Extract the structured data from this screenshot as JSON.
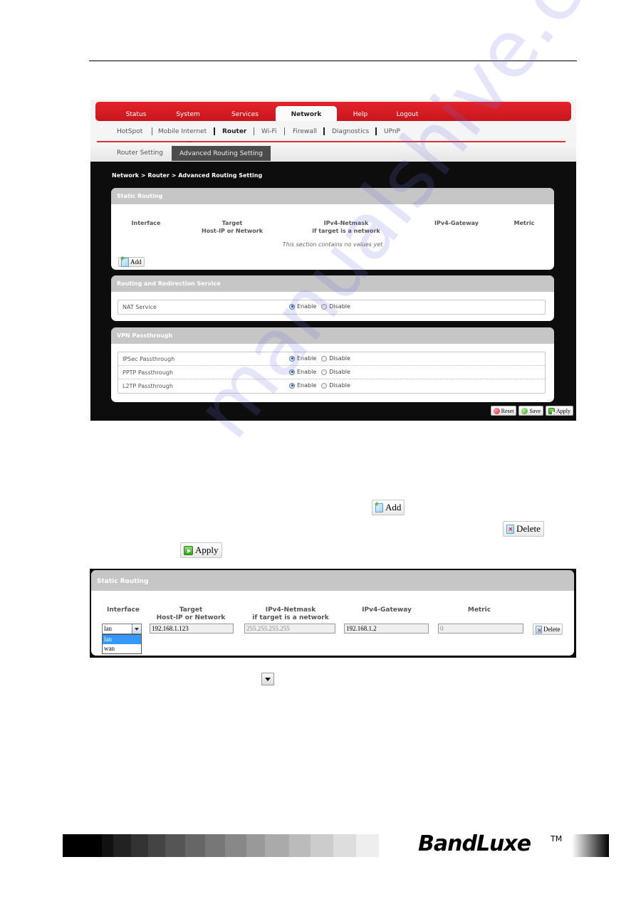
{
  "topnav": {
    "tabs": [
      {
        "label": "Status"
      },
      {
        "label": "System"
      },
      {
        "label": "Services"
      },
      {
        "label": "Network",
        "active": true
      },
      {
        "label": "Help"
      },
      {
        "label": "Logout"
      }
    ]
  },
  "subnav": {
    "items": [
      {
        "label": "HotSpot"
      },
      {
        "label": "Mobile Internet"
      },
      {
        "label": "Router",
        "active": true
      },
      {
        "label": "Wi-Fi"
      },
      {
        "label": "Firewall"
      },
      {
        "label": "Diagnostics"
      },
      {
        "label": "UPnP"
      }
    ]
  },
  "subsubnav": {
    "items": [
      {
        "label": "Router Setting"
      },
      {
        "label": "Advanced Routing Setting",
        "active": true
      }
    ]
  },
  "breadcrumb": "Network > Router > Advanced Routing Setting",
  "static_routing": {
    "title": "Static Routing",
    "columns": [
      {
        "line1": "Interface",
        "line2": ""
      },
      {
        "line1": "Target",
        "line2": "Host-IP or Network"
      },
      {
        "line1": "IPv4-Netmask",
        "line2": "if target is a network"
      },
      {
        "line1": "IPv4-Gateway",
        "line2": ""
      },
      {
        "line1": "Metric",
        "line2": ""
      }
    ],
    "empty_message": "This section contains no values yet",
    "add_label": "Add"
  },
  "routing_service": {
    "title": "Routing and Redirection Service",
    "rows": [
      {
        "label": "NAT Service",
        "selected": "Enable"
      }
    ]
  },
  "vpn": {
    "title": "VPN Passthrough",
    "rows": [
      {
        "label": "IPSec Passthrough",
        "selected": "Enable"
      },
      {
        "label": "PPTP Passthrough",
        "selected": "Enable"
      },
      {
        "label": "L2TP Passthrough",
        "selected": "Enable"
      }
    ]
  },
  "radio_options": {
    "enable": "Enable",
    "disable": "Disable"
  },
  "footer_buttons": {
    "reset": "Reset",
    "save": "Save",
    "apply": "Apply"
  },
  "inline_buttons": {
    "add": "Add",
    "delete": "Delete",
    "apply": "Apply"
  },
  "static_routing_edit": {
    "title": "Static Routing",
    "columns": [
      {
        "line1": "Interface",
        "line2": ""
      },
      {
        "line1": "Target",
        "line2": "Host-IP or Network"
      },
      {
        "line1": "IPv4-Netmask",
        "line2": "if target is a network"
      },
      {
        "line1": "IPv4-Gateway",
        "line2": ""
      },
      {
        "line1": "Metric",
        "line2": ""
      }
    ],
    "interface_value": "lan",
    "interface_options": [
      "lan",
      "wan"
    ],
    "target_value": "192.168.1.123",
    "netmask_placeholder": "255.255.255.255",
    "gateway_value": "192.168.1.2",
    "metric_placeholder": "0",
    "delete_label": "Delete"
  },
  "branding": {
    "logo": "BandLuxe",
    "tm": "TM"
  },
  "grayscale_swatches": [
    "#000000",
    "#111111",
    "#222222",
    "#333333",
    "#444444",
    "#555555",
    "#666666",
    "#777777",
    "#888888",
    "#999999",
    "#aaaaaa",
    "#bbbbbb",
    "#cccccc",
    "#dddddd",
    "#eeeeee"
  ],
  "watermark": "manualshive.com",
  "colors": {
    "accent_red": "#d6232b",
    "panel_header": "#c6c6c6",
    "dark_bg": "#0d0d0d"
  }
}
